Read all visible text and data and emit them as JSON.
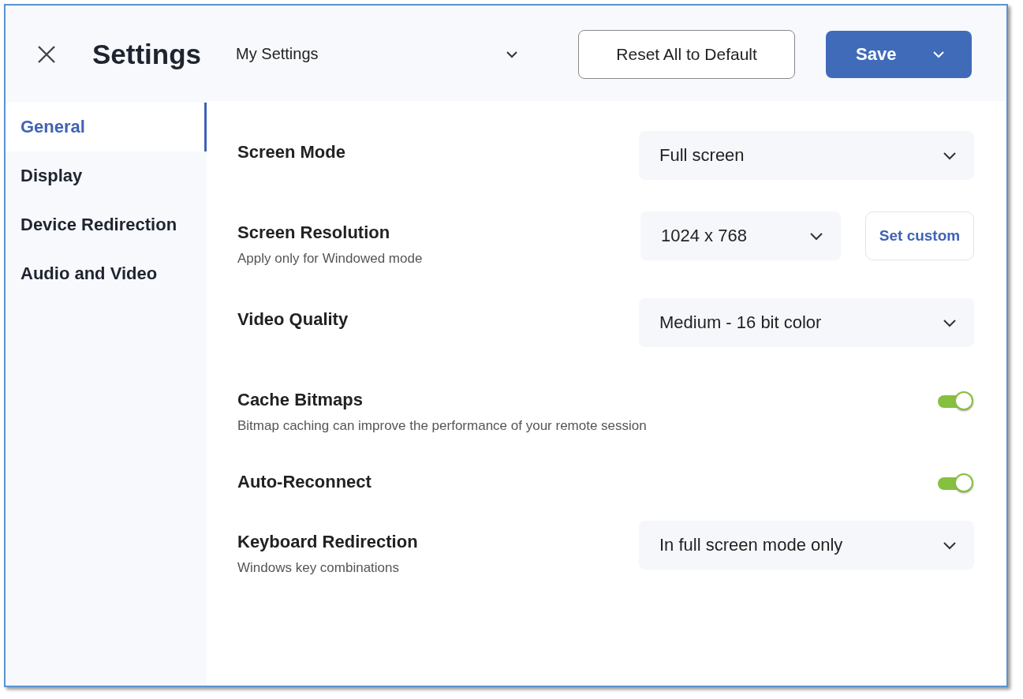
{
  "header": {
    "title": "Settings",
    "profile_select": {
      "value": "My Settings"
    },
    "reset_button": "Reset All to Default",
    "save_button": "Save"
  },
  "sidebar": {
    "items": [
      {
        "label": "General",
        "selected": true
      },
      {
        "label": "Display",
        "selected": false
      },
      {
        "label": "Device Redirection",
        "selected": false
      },
      {
        "label": "Audio and Video",
        "selected": false
      }
    ]
  },
  "settings": [
    {
      "kind": "select",
      "label": "Screen Mode",
      "value": "Full screen"
    },
    {
      "kind": "select-custom",
      "label": "Screen Resolution",
      "description": "Apply only for Windowed mode",
      "value": "1024 x 768",
      "button": "Set custom"
    },
    {
      "kind": "select",
      "label": "Video Quality",
      "value": "Medium - 16 bit color"
    },
    {
      "kind": "toggle",
      "label": "Cache Bitmaps",
      "description": "Bitmap caching can improve the performance of your remote session",
      "on": true
    },
    {
      "kind": "toggle",
      "label": "Auto-Reconnect",
      "on": true
    },
    {
      "kind": "select",
      "label": "Keyboard Redirection",
      "description": "Windows key combinations",
      "value": "In full screen mode only"
    }
  ]
}
